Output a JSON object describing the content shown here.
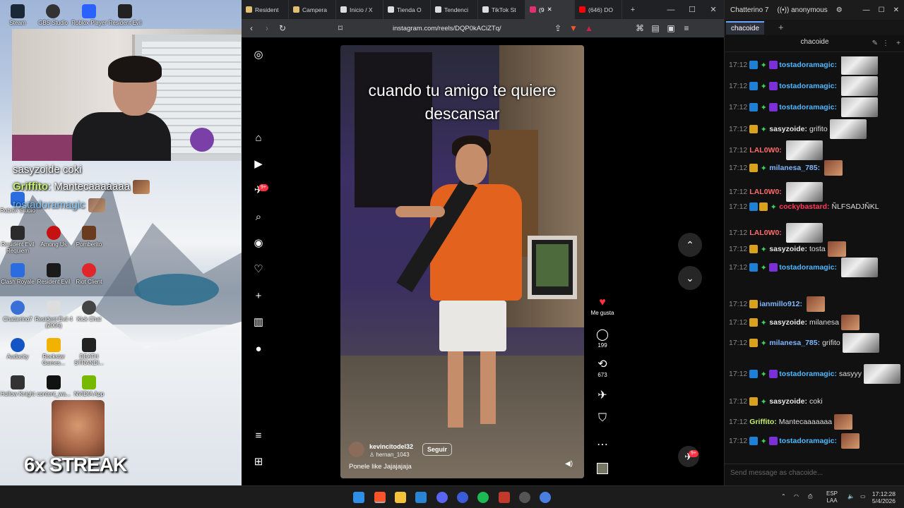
{
  "desktop": {
    "icons_top": [
      "Steam",
      "GBS Studio",
      "Roblox Player",
      "Resident Evil"
    ],
    "icons_grid": [
      {
        "label": "Roblox Studio"
      },
      {
        "label": "Resident Evil Requiem"
      },
      {
        "label": "Among Us"
      },
      {
        "label": "Pomberito"
      },
      {
        "label": "Clash Royale"
      },
      {
        "label": "Resident Evil"
      },
      {
        "label": "Riot Client"
      },
      {
        "label": "Chatterino7"
      },
      {
        "label": "Resident Evil 4 (2005)"
      },
      {
        "label": "Kick Chat"
      },
      {
        "label": "Audacity"
      },
      {
        "label": "Rockstar Games..."
      },
      {
        "label": "DEATH STRANDI..."
      },
      {
        "label": "Hollow Knight"
      },
      {
        "label": "content_wa..."
      },
      {
        "label": "NVIDIA App"
      }
    ],
    "overlay_chat": [
      {
        "user": "sasyzoide",
        "text": "coki"
      },
      {
        "user": "Griffito",
        "text": "Mantecaaaaaaa"
      },
      {
        "user": "tostadoramagic",
        "text": ""
      }
    ],
    "streak": "6x STREAK"
  },
  "browser": {
    "tabs": [
      {
        "label": "Resident",
        "color": "#e0c070"
      },
      {
        "label": "Campera",
        "color": "#e0c070"
      },
      {
        "label": "Inicio / X",
        "color": "#ffffff"
      },
      {
        "label": "Tienda O",
        "color": "#ffffff"
      },
      {
        "label": "Tendenci",
        "color": "#ffffff"
      },
      {
        "label": "TikTok St",
        "color": "#ffffff"
      },
      {
        "label": "(9",
        "color": "#e1306c"
      },
      {
        "label": "(646) DO",
        "color": "#ff0000"
      }
    ],
    "url": "instagram.com/reels/DQP0kACiZTq/",
    "instagram": {
      "notif_badge": "9+",
      "reel": {
        "caption": "cuando tu amigo te quiere descansar",
        "username": "kevincitodel32",
        "subuser": "hernan_1043",
        "follow": "Seguir",
        "description": "Ponele like Jajajajaja"
      },
      "actions": {
        "like_label": "Me gusta",
        "comments": "199",
        "reposts": "673"
      },
      "dm_badge": "9+"
    }
  },
  "chatterino": {
    "title": "Chatterino 7",
    "user": "anonymous",
    "tab": "chacoide",
    "channel": "chacoide",
    "messages": [
      {
        "time": "17:12",
        "badges": [
          "mod",
          "gem",
          "sub"
        ],
        "user": "tostadoramagic:",
        "color": "#4fb8ff",
        "text": "",
        "emote": true
      },
      {
        "time": "17:12",
        "badges": [
          "mod",
          "gem",
          "sub"
        ],
        "user": "tostadoramagic:",
        "color": "#4fb8ff",
        "text": "",
        "emote": true
      },
      {
        "time": "17:12",
        "badges": [
          "mod",
          "gem",
          "sub"
        ],
        "user": "tostadoramagic:",
        "color": "#4fb8ff",
        "text": "",
        "emote": true
      },
      {
        "time": "17:12",
        "badges": [
          "vip",
          "gem"
        ],
        "user": "sasyzoide:",
        "color": "#e6e6e6",
        "text": "grifito",
        "emote": true
      },
      {
        "time": "17:12",
        "badges": [],
        "user": "LAL0W0:",
        "color": "#ff6b6b",
        "text": "",
        "emote": true
      },
      {
        "time": "17:12",
        "badges": [
          "vip",
          "gem"
        ],
        "user": "milanesa_785:",
        "color": "#7fb6ff",
        "text": "",
        "emote": true
      },
      {
        "time": "17:12",
        "badges": [],
        "user": "LAL0W0:",
        "color": "#ff6b6b",
        "text": "",
        "emote": true
      },
      {
        "time": "17:12",
        "badges": [
          "mod",
          "vip",
          "gem"
        ],
        "user": "cockybastard:",
        "color": "#ff3b5c",
        "text": "ÑLFSADJÑKL",
        "emote": false
      },
      {
        "time": "17:12",
        "badges": [],
        "user": "LAL0W0:",
        "color": "#ff6b6b",
        "text": "",
        "emote": true
      },
      {
        "time": "17:12",
        "badges": [
          "vip",
          "gem"
        ],
        "user": "sasyzoide:",
        "color": "#e6e6e6",
        "text": "tosta",
        "emote": true
      },
      {
        "time": "17:12",
        "badges": [
          "mod",
          "gem",
          "sub"
        ],
        "user": "tostadoramagic:",
        "color": "#4fb8ff",
        "text": "",
        "emote": true
      },
      {
        "time": "17:12",
        "badges": [
          "vip"
        ],
        "user": "ianmillo912:",
        "color": "#7fb6ff",
        "text": "",
        "emote": true
      },
      {
        "time": "17:12",
        "badges": [
          "vip",
          "gem"
        ],
        "user": "sasyzoide:",
        "color": "#e6e6e6",
        "text": "milanesa",
        "emote": true
      },
      {
        "time": "17:12",
        "badges": [
          "vip",
          "gem"
        ],
        "user": "milanesa_785:",
        "color": "#7fb6ff",
        "text": "grifito",
        "emote": true
      },
      {
        "time": "17:12",
        "badges": [
          "mod",
          "gem",
          "sub"
        ],
        "user": "tostadoramagic:",
        "color": "#4fb8ff",
        "text": "sasyyy",
        "emote": true
      },
      {
        "time": "17:12",
        "badges": [
          "vip",
          "gem"
        ],
        "user": "sasyzoide:",
        "color": "#e6e6e6",
        "text": "coki",
        "emote": false
      },
      {
        "time": "17:12",
        "badges": [],
        "user": "Griffito:",
        "color": "#c6f06a",
        "text": "Mantecaaaaaaa",
        "emote": true
      },
      {
        "time": "17:12",
        "badges": [
          "mod",
          "gem",
          "sub"
        ],
        "user": "tostadoramagic:",
        "color": "#4fb8ff",
        "text": "",
        "emote": true
      }
    ],
    "input_placeholder": "Send message as chacoide..."
  },
  "taskbar": {
    "lang_top": "ESP",
    "lang_bottom": "LAA",
    "time": "17:12:28",
    "date": "5/4/2026"
  }
}
